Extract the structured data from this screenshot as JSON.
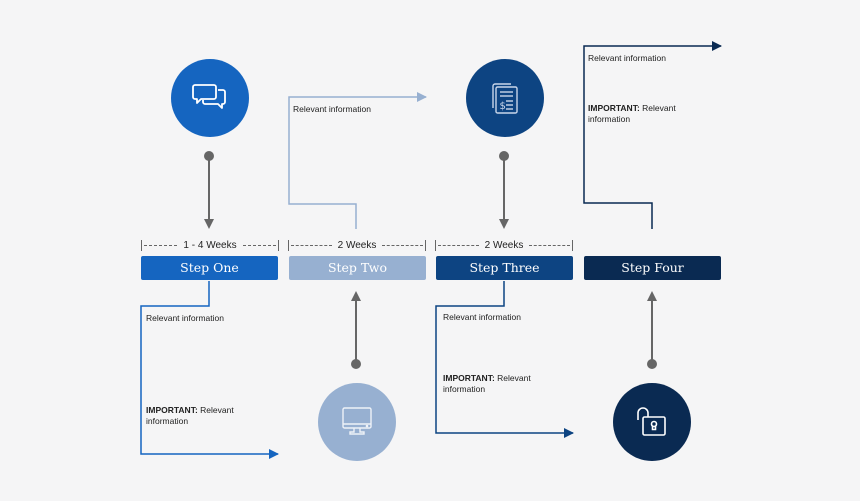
{
  "steps": [
    {
      "label": "Step One",
      "duration": "1 - 4 Weeks",
      "color": "#1565c0",
      "icon": "chat-bubbles-icon",
      "notes": {
        "info": "Relevant information",
        "important_label": "IMPORTANT:",
        "important_text": " Relevant information"
      }
    },
    {
      "label": "Step Two",
      "duration": "2 Weeks",
      "color": "#97b0d1",
      "icon": "monitor-icon",
      "notes": {
        "info": "Relevant information"
      }
    },
    {
      "label": "Step Three",
      "duration": "2 Weeks",
      "color": "#0d4482",
      "icon": "invoice-document-icon",
      "notes": {
        "info": "Relevant information",
        "important_label": "IMPORTANT:",
        "important_text": " Relevant information"
      }
    },
    {
      "label": "Step Four",
      "duration": "",
      "color": "#0a2a52",
      "icon": "unlock-icon",
      "notes": {
        "info": "Relevant information",
        "important_label": "IMPORTANT:",
        "important_text": " Relevant information"
      }
    }
  ],
  "colors": {
    "connector": "#666666",
    "background": "#f5f5f6"
  }
}
